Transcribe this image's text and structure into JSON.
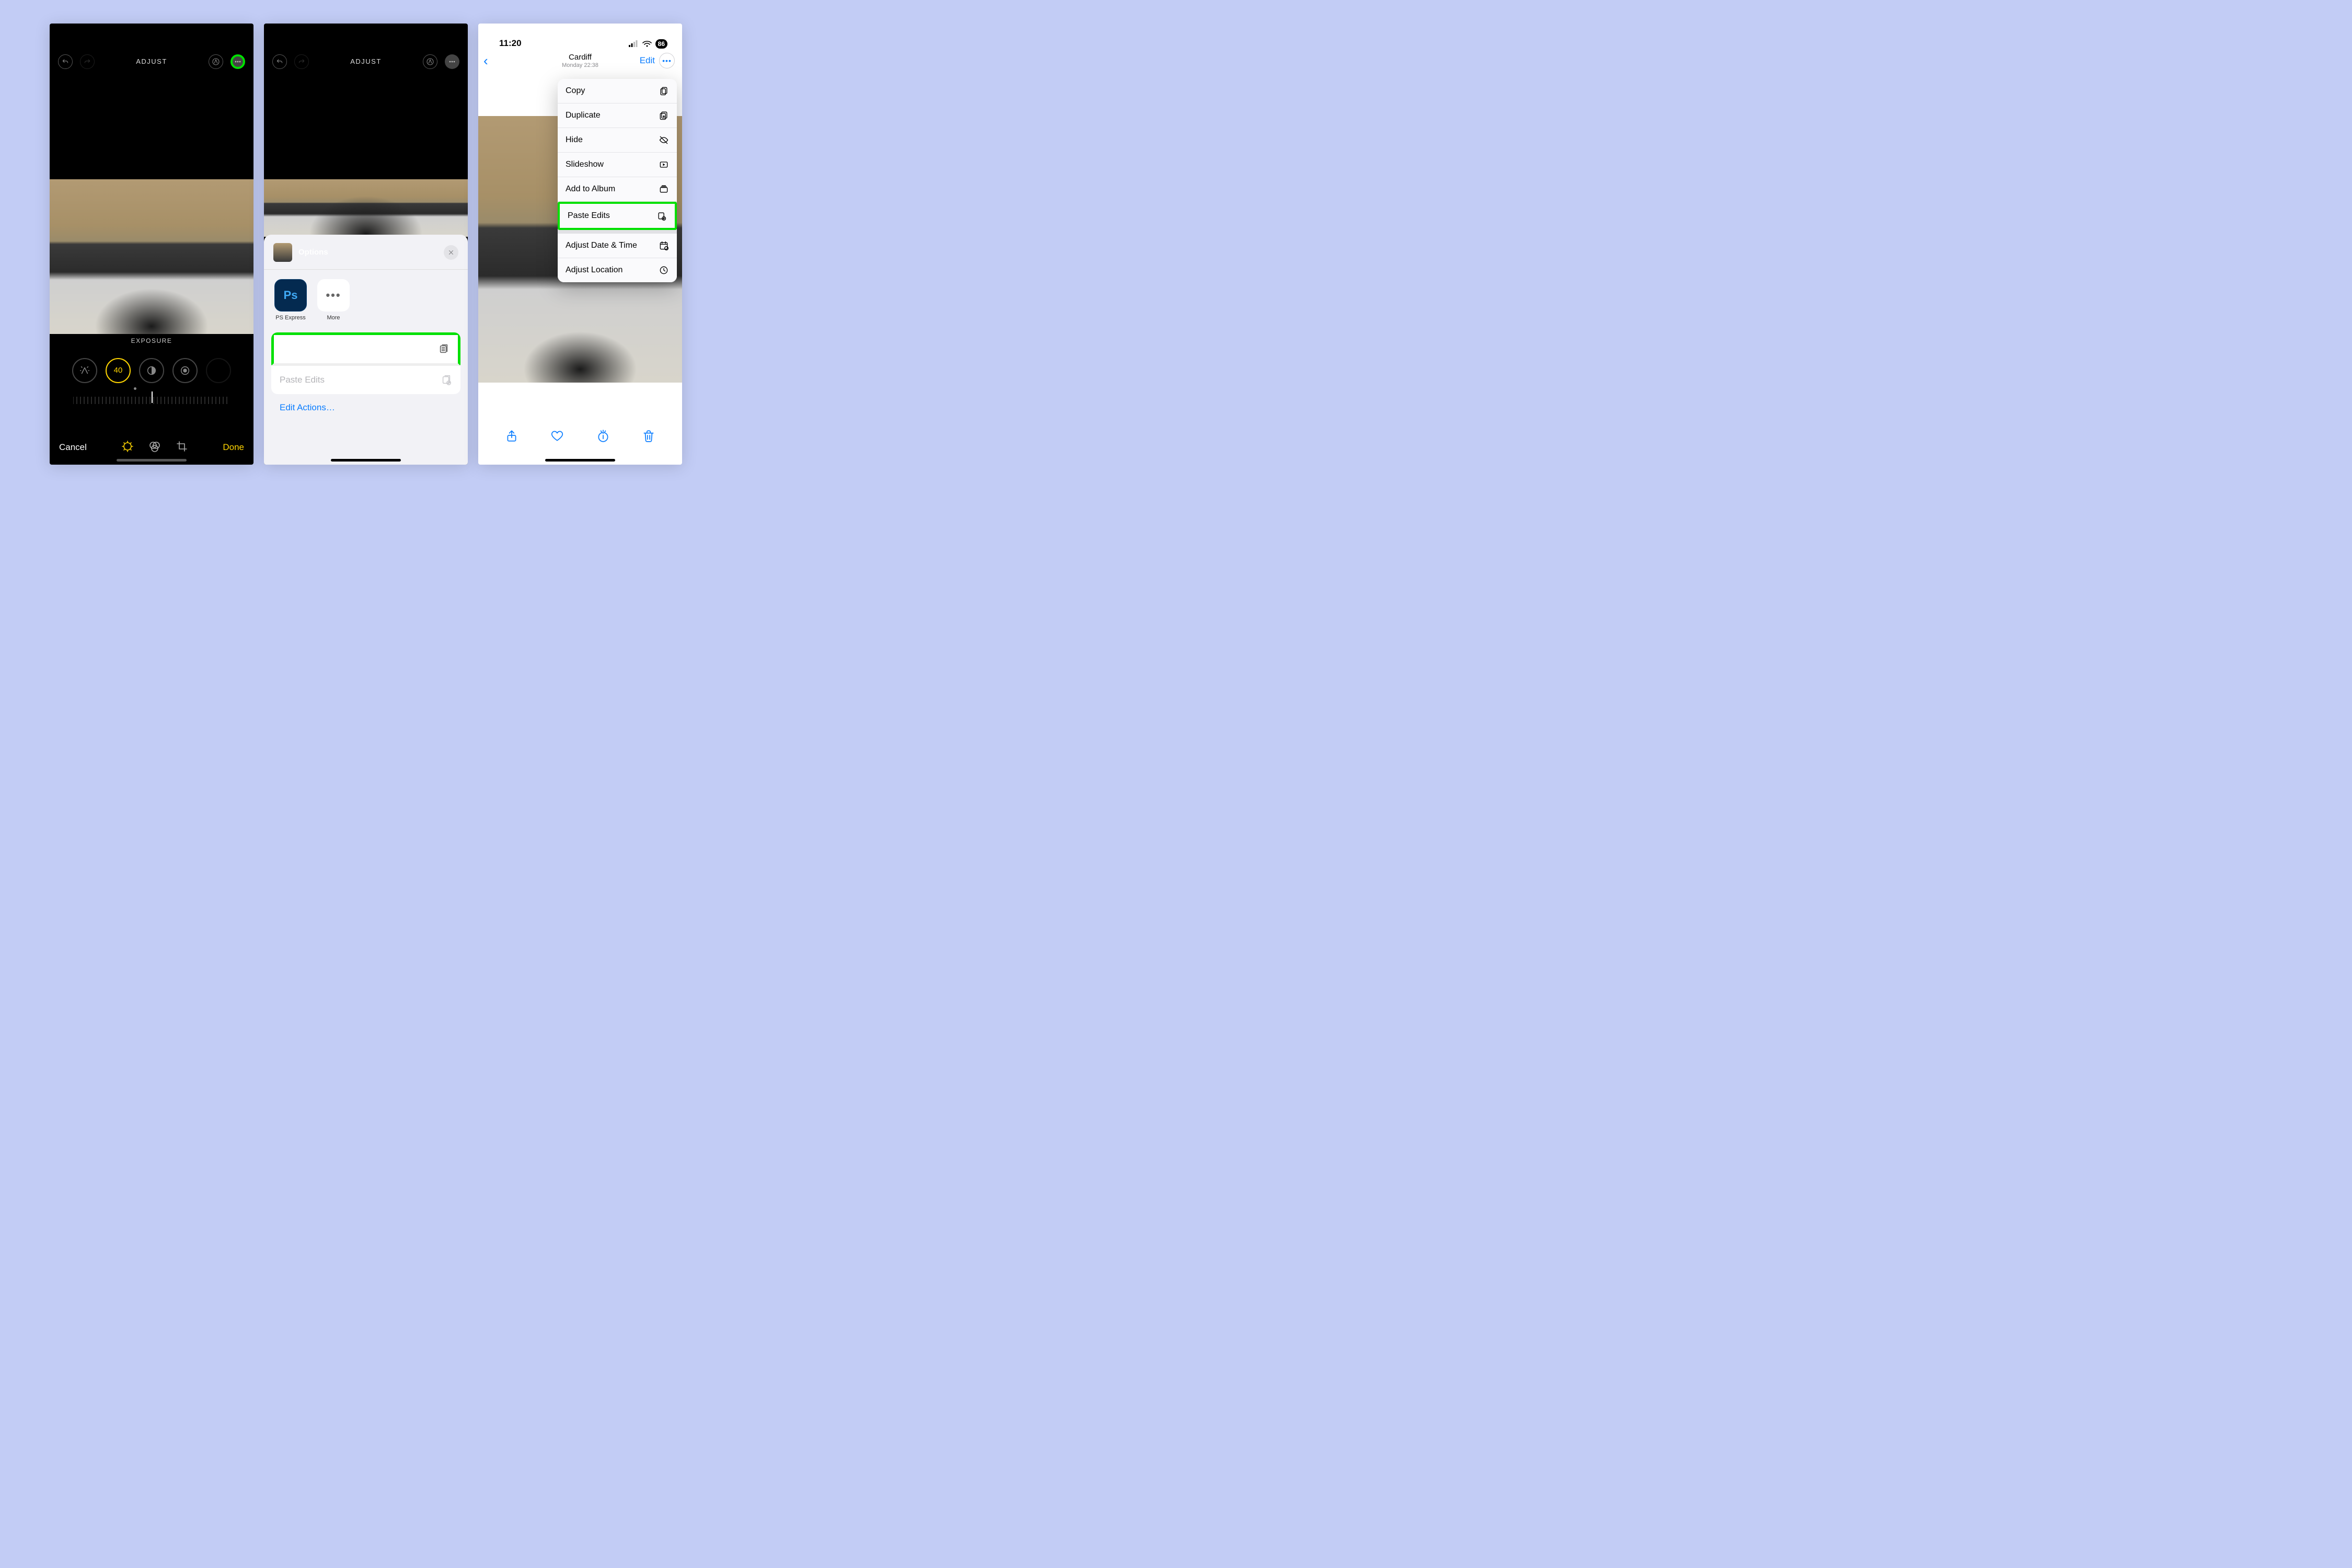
{
  "panel1": {
    "title": "ADJUST",
    "param_label": "EXPOSURE",
    "exposure_value": "40",
    "cancel": "Cancel",
    "done": "Done"
  },
  "panel2": {
    "title": "ADJUST",
    "sheet_title": "Options",
    "apps": {
      "ps": "PS Express",
      "more": "More"
    },
    "copy_edits": "Copy Edits",
    "paste_edits": "Paste Edits",
    "edit_actions": "Edit Actions…"
  },
  "panel3": {
    "time": "11:20",
    "battery": "86",
    "location": "Cardiff",
    "datetime": "Monday  22:38",
    "edit": "Edit",
    "menu": {
      "copy": "Copy",
      "duplicate": "Duplicate",
      "hide": "Hide",
      "slideshow": "Slideshow",
      "add_to_album": "Add to Album",
      "paste_edits": "Paste Edits",
      "adjust_dt": "Adjust Date & Time",
      "adjust_loc": "Adjust Location"
    }
  }
}
